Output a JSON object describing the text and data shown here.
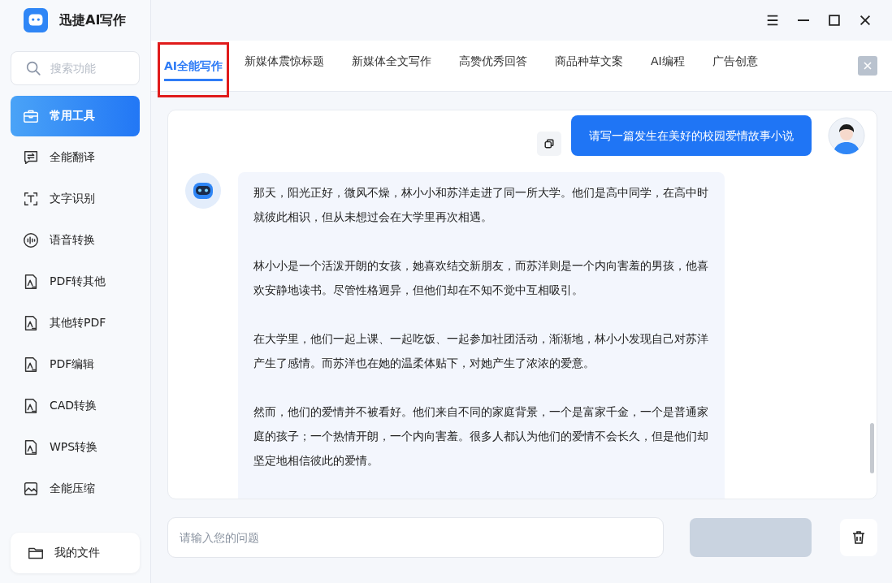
{
  "app": {
    "title": "迅捷AI写作"
  },
  "sidebar": {
    "search": {
      "placeholder": "搜索功能"
    },
    "items": [
      {
        "label": "常用工具",
        "kind": "toolbox",
        "selected": true
      },
      {
        "label": "全能翻译",
        "kind": "translate",
        "selected": false
      },
      {
        "label": "文字识别",
        "kind": "text",
        "selected": false
      },
      {
        "label": "语音转换",
        "kind": "voice",
        "selected": false
      },
      {
        "label": "PDF转其他",
        "kind": "doc",
        "selected": false
      },
      {
        "label": "其他转PDF",
        "kind": "doc",
        "selected": false
      },
      {
        "label": "PDF编辑",
        "kind": "doc",
        "selected": false
      },
      {
        "label": "CAD转换",
        "kind": "doc",
        "selected": false
      },
      {
        "label": "WPS转换",
        "kind": "doc",
        "selected": false
      },
      {
        "label": "全能压缩",
        "kind": "compress",
        "selected": false
      }
    ],
    "footer": {
      "label": "我的文件"
    }
  },
  "tabs": [
    {
      "label": "AI全能写作",
      "selected": true,
      "highlighted": true
    },
    {
      "label": "新媒体震惊标题",
      "selected": false,
      "highlighted": false
    },
    {
      "label": "新媒体全文写作",
      "selected": false,
      "highlighted": false
    },
    {
      "label": "高赞优秀回答",
      "selected": false,
      "highlighted": false
    },
    {
      "label": "商品种草文案",
      "selected": false,
      "highlighted": false
    },
    {
      "label": "AI编程",
      "selected": false,
      "highlighted": false
    },
    {
      "label": "广告创意",
      "selected": false,
      "highlighted": false
    }
  ],
  "messages": [
    {
      "kind": "user",
      "text": "请写一篇发生在美好的校园爱情故事小说"
    },
    {
      "kind": "bot",
      "paragraphs": [
        "那天，阳光正好，微风不燥，林小小和苏洋走进了同一所大学。他们是高中同学，在高中时就彼此相识，但从未想过会在大学里再次相遇。",
        "林小小是一个活泼开朗的女孩，她喜欢结交新朋友，而苏洋则是一个内向害羞的男孩，他喜欢安静地读书。尽管性格迥异，但他们却在不知不觉中互相吸引。",
        "在大学里，他们一起上课、一起吃饭、一起参加社团活动，渐渐地，林小小发现自己对苏洋产生了感情。而苏洋也在她的温柔体贴下，对她产生了浓浓的爱意。",
        "然而，他们的爱情并不被看好。他们来自不同的家庭背景，一个是富家千金，一个是普通家庭的孩子；一个热情开朗，一个内向害羞。很多人都认为他们的爱情不会长久，但是他们却坚定地相信彼此的爱情。"
      ]
    }
  ],
  "input": {
    "placeholder": "请输入您的问题"
  },
  "send_button": {
    "disabled": true
  }
}
